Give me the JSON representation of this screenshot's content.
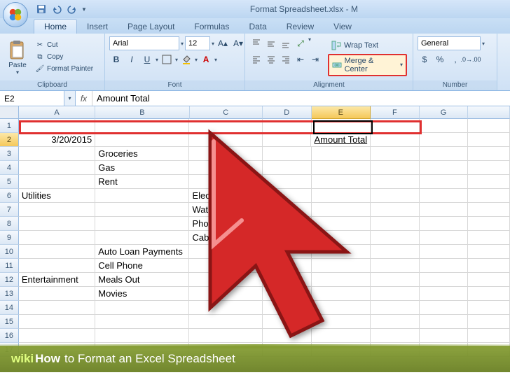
{
  "title": "Format Spreadsheet.xlsx - M",
  "tabs": [
    "Home",
    "Insert",
    "Page Layout",
    "Formulas",
    "Data",
    "Review",
    "View"
  ],
  "activeTab": "Home",
  "ribbon": {
    "clipboard": {
      "paste": "Paste",
      "cut": "Cut",
      "copy": "Copy",
      "painter": "Format Painter",
      "title": "Clipboard"
    },
    "font": {
      "name": "Arial",
      "size": "12",
      "title": "Font"
    },
    "alignment": {
      "wrap": "Wrap Text",
      "merge": "Merge & Center",
      "title": "Alignment"
    },
    "number": {
      "format": "General",
      "title": "Number"
    }
  },
  "nameBox": "E2",
  "formula": "Amount Total",
  "columns": [
    "A",
    "B",
    "C",
    "D",
    "E",
    "F",
    "G",
    ""
  ],
  "selectedCol": "E",
  "selectedRow": 2,
  "cells": {
    "r2": {
      "A": "3/20/2015",
      "E": "Amount Total"
    },
    "r3": {
      "B": "Groceries"
    },
    "r4": {
      "B": "Gas"
    },
    "r5": {
      "B": "Rent"
    },
    "r6": {
      "A": "Utilities",
      "C": "Electric"
    },
    "r7": {
      "C": "Water/Sewage"
    },
    "r8": {
      "C": "Phone"
    },
    "r9": {
      "C": "Cable/Internet"
    },
    "r10": {
      "B": "Auto Loan Payments"
    },
    "r11": {
      "B": "Cell Phone"
    },
    "r12": {
      "A": "Entertainment",
      "B": "Meals Out"
    },
    "r13": {
      "B": "Movies"
    }
  },
  "watermark": {
    "wiki": "wiki",
    "how": "How",
    "to": "to Format an Excel Spreadsheet"
  }
}
